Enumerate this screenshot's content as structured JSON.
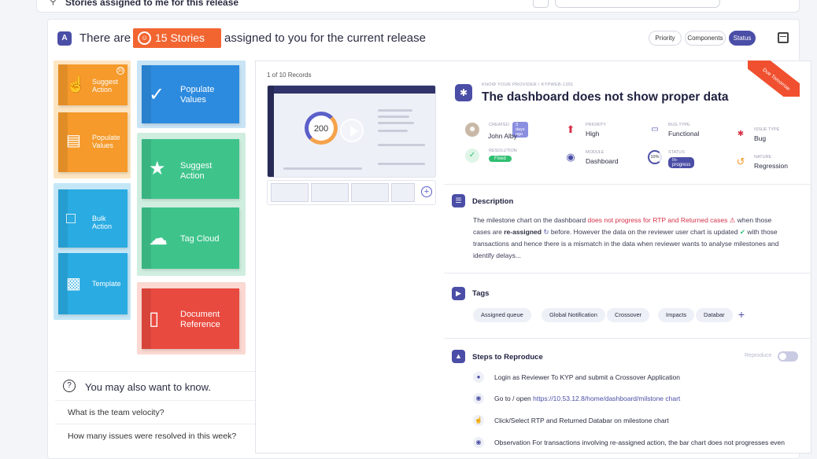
{
  "topbar": {
    "title": "Stories assigned to me for this release"
  },
  "header": {
    "text_before": "There are",
    "pill": "15 Stories",
    "text_after": "assigned to you for the current release",
    "filters": [
      "Priority",
      "Components",
      "Status"
    ],
    "active_filter": "Status"
  },
  "tiles": {
    "suggest_small": "Suggest Action",
    "suggest_small_count": "10",
    "populate_small": "Populate Values",
    "populate_big": "Populate Values",
    "suggest_big": "Suggest Action",
    "bulk": "Bulk Action",
    "template": "Template",
    "tagcloud": "Tag Cloud",
    "docref": "Document Reference"
  },
  "faq": {
    "title": "You may also want to know.",
    "items": [
      "What is the team velocity?",
      "How many issues were resolved in this week?"
    ]
  },
  "records": "1 of 10 Records",
  "preview": {
    "donut_value": "200"
  },
  "story": {
    "project": "KNOW YOUR PROVIDER / KYPWEB-1391",
    "title": "The dashboard does not show proper data",
    "ribbon": "Due Tomorrow",
    "meta": {
      "created_label": "CREATED",
      "created_ago": "3 days ago",
      "created_by": "John Alby",
      "priority_label": "PRIORITY",
      "priority": "High",
      "bugtype_label": "BUG TYPE",
      "bugtype": "Functional",
      "issuetype_label": "ISSUE TYPE",
      "issuetype": "Bug",
      "resolution_label": "RESOLUTION",
      "resolution": "Fixed",
      "module_label": "MODULE",
      "module": "Dashboard",
      "status_label": "STATUS",
      "status": "In-progress",
      "status_pct": "10%",
      "nature_label": "NATURE",
      "nature": "Regression"
    }
  },
  "description": {
    "title": "Description",
    "p1": "The milestone chart on the dashboard",
    "p1_red": "does not progress for RTP and Returned cases",
    "p1_end": "when those",
    "p2": "cases are",
    "p2_bold": "re-assigned",
    "p2_end": "before. However the data on the reviewer user chart is updated",
    "p2_tail": "with those",
    "p3": "transactions and hence there is a mismatch in the data when reviewer wants to analyse milestones and",
    "p4": "identify delays..."
  },
  "tags": {
    "title": "Tags",
    "items": [
      "Assigned queue",
      "Global Notification",
      "Crossover",
      "Impacts",
      "Databar"
    ]
  },
  "steps": {
    "title": "Steps to Reproduce",
    "reproduce_label": "Reproduce",
    "items": [
      {
        "text": "Login as Reviewer  To KYP and submit a Crossover Application"
      },
      {
        "text": "Go to / open",
        "link": "https://10.53.12.8/home/dashboard/milstone chart"
      },
      {
        "text": "Click/Select  RTP and Returned Databar on milestone chart"
      },
      {
        "text": "Observation  For transactions involving re-assigned action, the bar chart does not progresses even"
      }
    ]
  }
}
